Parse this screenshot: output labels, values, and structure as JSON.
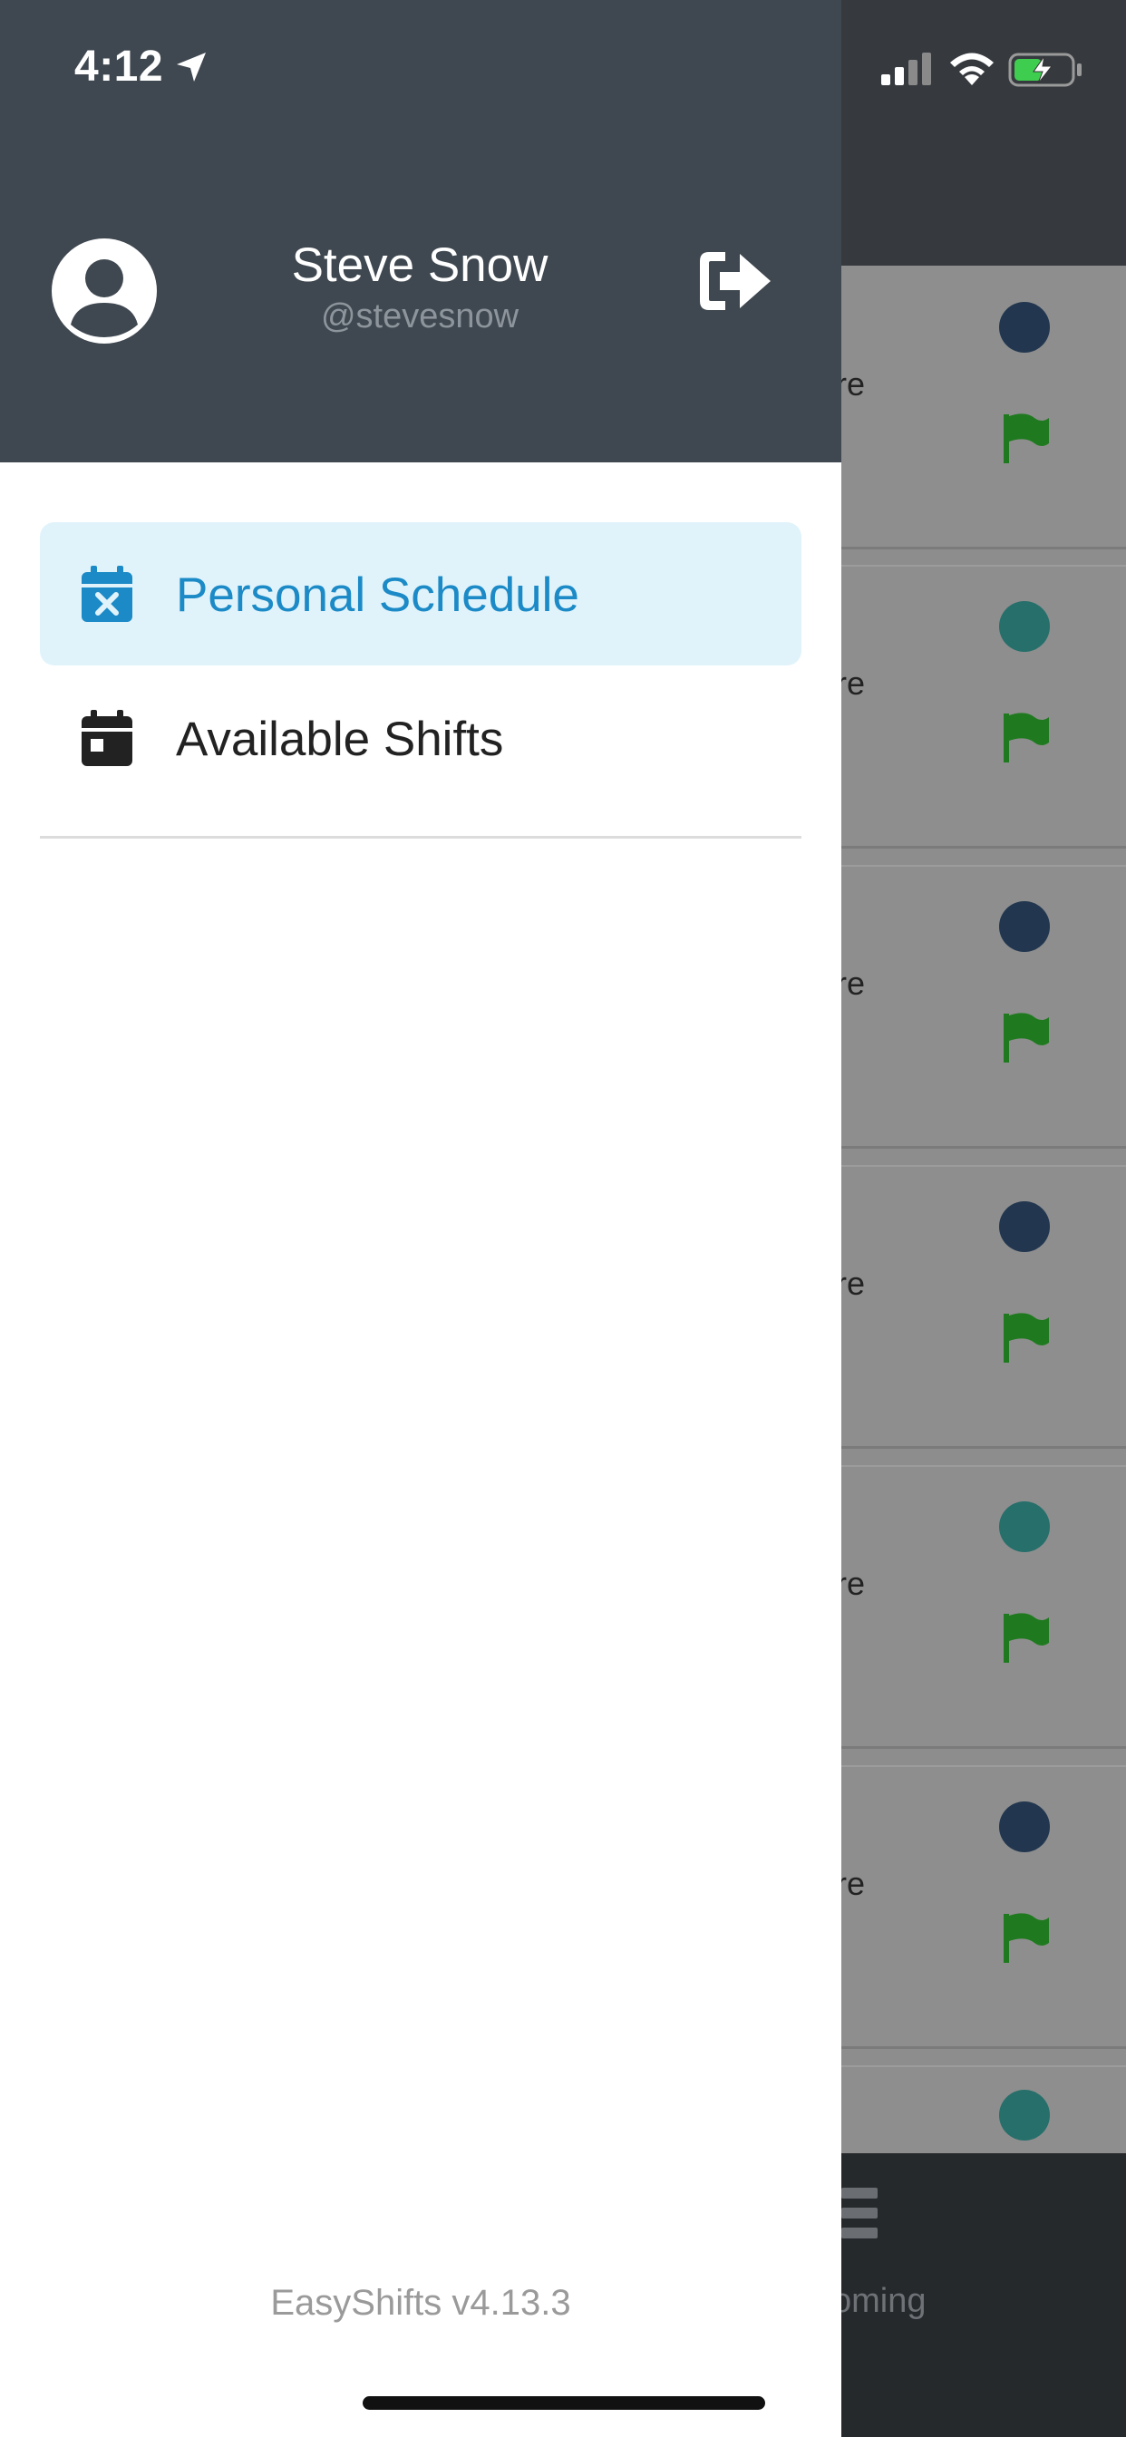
{
  "status_bar": {
    "time": "4:12"
  },
  "user": {
    "name": "Steve Snow",
    "handle": "@stevesnow"
  },
  "menu": {
    "items": [
      {
        "label": "Personal Schedule",
        "icon": "calendar-x-icon",
        "active": true
      },
      {
        "label": "Available Shifts",
        "icon": "calendar-icon",
        "active": false
      }
    ]
  },
  "footer": {
    "version": "EasyShifts v4.13.3"
  },
  "background": {
    "row_text": "re",
    "tab_label": "oming",
    "dot_colors": [
      "#22374f",
      "#276f6b",
      "#22374f",
      "#22374f",
      "#276f6b",
      "#22374f",
      "#276f6b"
    ]
  },
  "colors": {
    "header_bg": "#3f4850",
    "active_bg": "#e0f3fb",
    "accent": "#1b8ac6",
    "flag": "#1f7a1f"
  }
}
